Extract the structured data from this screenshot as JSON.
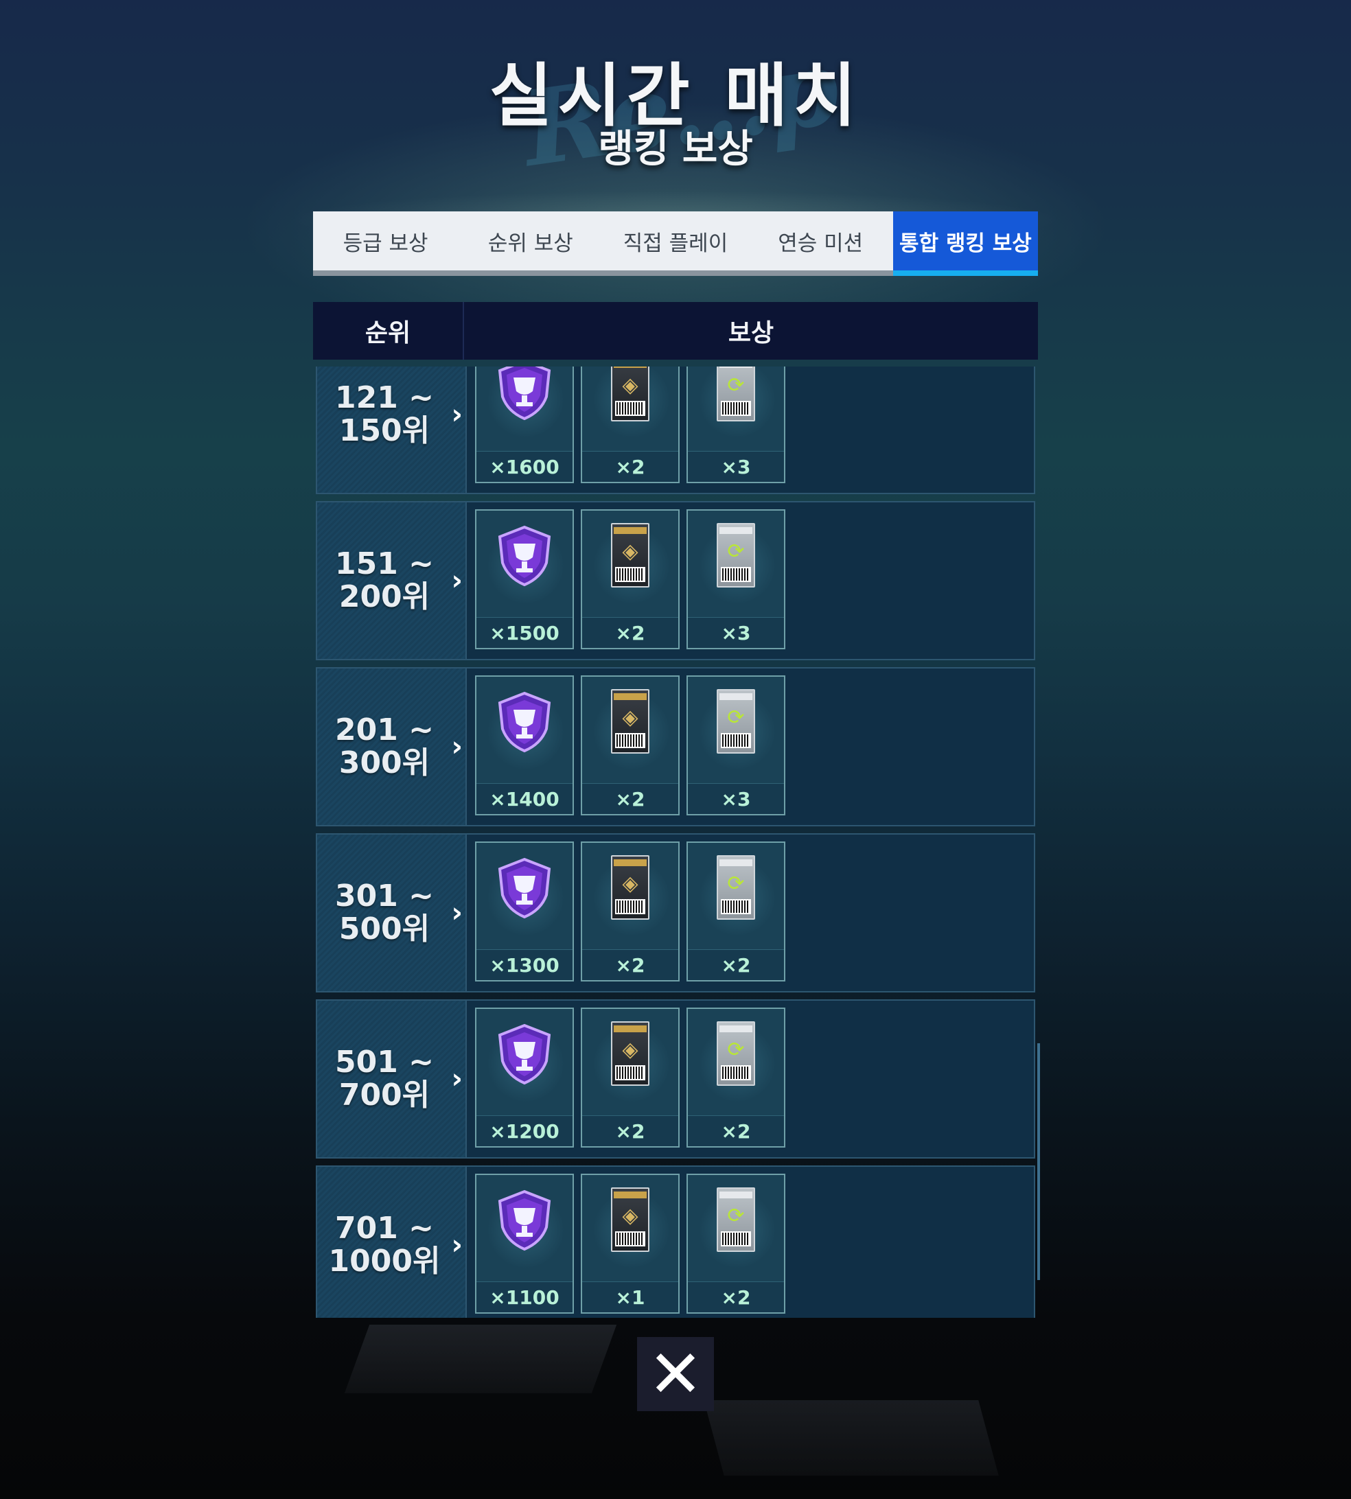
{
  "header": {
    "title": "실시간 매치",
    "subtitle": "랭킹 보상"
  },
  "tabs": [
    {
      "label": "등급 보상",
      "active": false
    },
    {
      "label": "순위 보상",
      "active": false
    },
    {
      "label": "직접 플레이",
      "active": false
    },
    {
      "label": "연승 미션",
      "active": false
    },
    {
      "label": "통합 랭킹 보상",
      "active": true
    }
  ],
  "table": {
    "col_rank": "순위",
    "col_reward": "보상"
  },
  "rows": [
    {
      "rank_line1": "121 ~",
      "rank_line2": "150위",
      "rewards": [
        {
          "icon": "trophy-badge-icon",
          "count": "×1600"
        },
        {
          "icon": "bonus-reset-ticket-icon",
          "count": "×2"
        },
        {
          "icon": "potential-reset-ticket-icon",
          "count": "×3"
        }
      ]
    },
    {
      "rank_line1": "151 ~",
      "rank_line2": "200위",
      "rewards": [
        {
          "icon": "trophy-badge-icon",
          "count": "×1500"
        },
        {
          "icon": "bonus-reset-ticket-icon",
          "count": "×2"
        },
        {
          "icon": "potential-reset-ticket-icon",
          "count": "×3"
        }
      ]
    },
    {
      "rank_line1": "201 ~",
      "rank_line2": "300위",
      "rewards": [
        {
          "icon": "trophy-badge-icon",
          "count": "×1400"
        },
        {
          "icon": "bonus-reset-ticket-icon",
          "count": "×2"
        },
        {
          "icon": "potential-reset-ticket-icon",
          "count": "×3"
        }
      ]
    },
    {
      "rank_line1": "301 ~",
      "rank_line2": "500위",
      "rewards": [
        {
          "icon": "trophy-badge-icon",
          "count": "×1300"
        },
        {
          "icon": "bonus-reset-ticket-icon",
          "count": "×2"
        },
        {
          "icon": "potential-reset-ticket-icon",
          "count": "×2"
        }
      ]
    },
    {
      "rank_line1": "501 ~",
      "rank_line2": "700위",
      "rewards": [
        {
          "icon": "trophy-badge-icon",
          "count": "×1200"
        },
        {
          "icon": "bonus-reset-ticket-icon",
          "count": "×2"
        },
        {
          "icon": "potential-reset-ticket-icon",
          "count": "×2"
        }
      ]
    },
    {
      "rank_line1": "701 ~",
      "rank_line2": "1000위",
      "rewards": [
        {
          "icon": "trophy-badge-icon",
          "count": "×1100"
        },
        {
          "icon": "bonus-reset-ticket-icon",
          "count": "×1"
        },
        {
          "icon": "potential-reset-ticket-icon",
          "count": "×2"
        }
      ]
    }
  ],
  "close_icon": "close-icon",
  "colors": {
    "active_tab": "#1559d8",
    "active_tab_underline": "#17aef0",
    "table_header": "#0c1434",
    "count_text": "#b9f1d8",
    "trophy_purple": "#7a3ad8"
  }
}
